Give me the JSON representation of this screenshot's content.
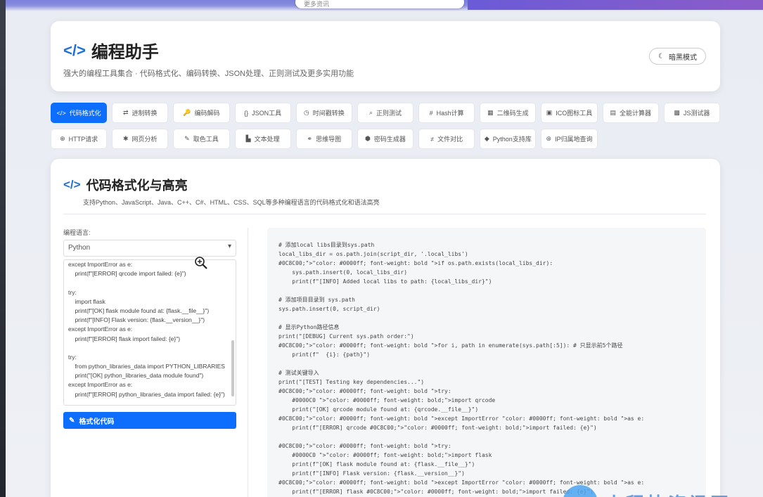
{
  "browser": {
    "search_placeholder": "更多资讯"
  },
  "header": {
    "title": "编程助手",
    "subtitle": "强大的编程工具集合 · 代码格式化、编码转换、JSON处理、正则测试及更多实用功能",
    "dark_mode_label": "暗黑模式"
  },
  "tools": [
    {
      "label": "代码格式化",
      "icon": "</>",
      "active": true
    },
    {
      "label": "进制转换",
      "icon": "⇄"
    },
    {
      "label": "编码解码",
      "icon": "🔑"
    },
    {
      "label": "JSON工具",
      "icon": "{}"
    },
    {
      "label": "时间戳转换",
      "icon": "◷"
    },
    {
      "label": "正则测试",
      "icon": "⌕"
    },
    {
      "label": "Hash计算",
      "icon": "#"
    },
    {
      "label": "二维码生成",
      "icon": "▦"
    },
    {
      "label": "ICO图标工具",
      "icon": "▣"
    },
    {
      "label": "全能计算器",
      "icon": "▤"
    },
    {
      "label": "JS测试器",
      "icon": "▩"
    },
    {
      "label": "HTTP请求",
      "icon": "⊕"
    },
    {
      "label": "网页分析",
      "icon": "✱"
    },
    {
      "label": "取色工具",
      "icon": "✎"
    },
    {
      "label": "文本处理",
      "icon": "▙"
    },
    {
      "label": "思维导图",
      "icon": "⚭"
    },
    {
      "label": "密码生成器",
      "icon": "⬢"
    },
    {
      "label": "文件对比",
      "icon": "≠"
    },
    {
      "label": "Python支持库",
      "icon": "◆"
    },
    {
      "label": "IP归属地查询",
      "icon": "⊛"
    }
  ],
  "section": {
    "title": "代码格式化与高亮",
    "description": "支持Python、JavaScript、Java、C++、C#、HTML、CSS、SQL等多种编程语言的代码格式化和语法高亮",
    "language_label": "编程语言:",
    "language_value": "Python",
    "format_button": "格式化代码"
  },
  "input_code": [
    "except ImportError as e:",
    "    print(f\"[ERROR] qrcode import failed: {e}\")",
    "",
    "try:",
    "    import flask",
    "    print(f\"[OK] flask module found at: {flask.__file__}\")",
    "    print(f\"[INFO] Flask version: {flask.__version__}\")",
    "except ImportError as e:",
    "    print(f\"[ERROR] flask import failed: {e}\")",
    "",
    "try:",
    "    from python_libraries_data import PYTHON_LIBRARIES",
    "    print(\"[OK] python_libraries_data module found\")",
    "except ImportError as e:",
    "    print(f\"[ERROR] python_libraries_data import failed: {e}\")"
  ],
  "output_code": [
    "# 添加local libs目录到sys.path",
    "local_libs_dir = os.path.join(script_dir, '.local_libs')",
    "#0C8C00;\">\"color: #0000ff; font-weight: bold \">if os.path.exists(local_libs_dir):",
    "    sys.path.insert(0, local_libs_dir)",
    "    print(f\"[INFO] Added local libs to path: {local_libs_dir}\")",
    "",
    "# 添加项目目录到 sys.path",
    "sys.path.insert(0, script_dir)",
    "",
    "# 显示Python路径信息",
    "print(\"[DEBUG] Current sys.path order:\")",
    "#0C8C00;\">\"color: #0000ff; font-weight: bold \">for i, path in enumerate(sys.path[:5]): # 只显示前5个路径",
    "    print(f\"  {i}: {path}\")",
    "",
    "# 测试关键导入",
    "print(\"[TEST] Testing key dependencies...\")",
    "#0C8C00;\">\"color: #0000ff; font-weight: bold \">try:",
    "    #0000C0 \">\"color: #0000ff; font-weight: bold;\">import qrcode",
    "    print(\"[OK] qrcode module found at: {qrcode.__file__}\")",
    "#0C8C00;\">\"color: #0000ff; font-weight: bold \">except ImportError \"color: #0000ff; font-weight: bold \">as e:",
    "    print(f\"[ERROR] qrcode #0C8C00;\">\"color: #0000ff; font-weight: bold;\">import failed: {e}\")",
    "",
    "#0C8C00;\">\"color: #0000ff; font-weight: bold \">try:",
    "    #0000C0 \">\"color: #0000ff; font-weight: bold;\">import flask",
    "    print(f\"[OK] flask module found at: {flask.__file__}\")",
    "    print(f\"[INFO] Flask version: {flask.__version__}\")",
    "#0C8C00;\">\"color: #0000ff; font-weight: bold \">except ImportError \"color: #0000ff; font-weight: bold \">as e:",
    "    print(f\"[ERROR] flask #0C8C00;\">\"color: #0000ff; font-weight: bold;\">import failed: {e}\")"
  ],
  "watermark": "小程快资讯网",
  "colors": {
    "accent": "#0d6efd",
    "brand_icon": "#1e6fd9"
  }
}
